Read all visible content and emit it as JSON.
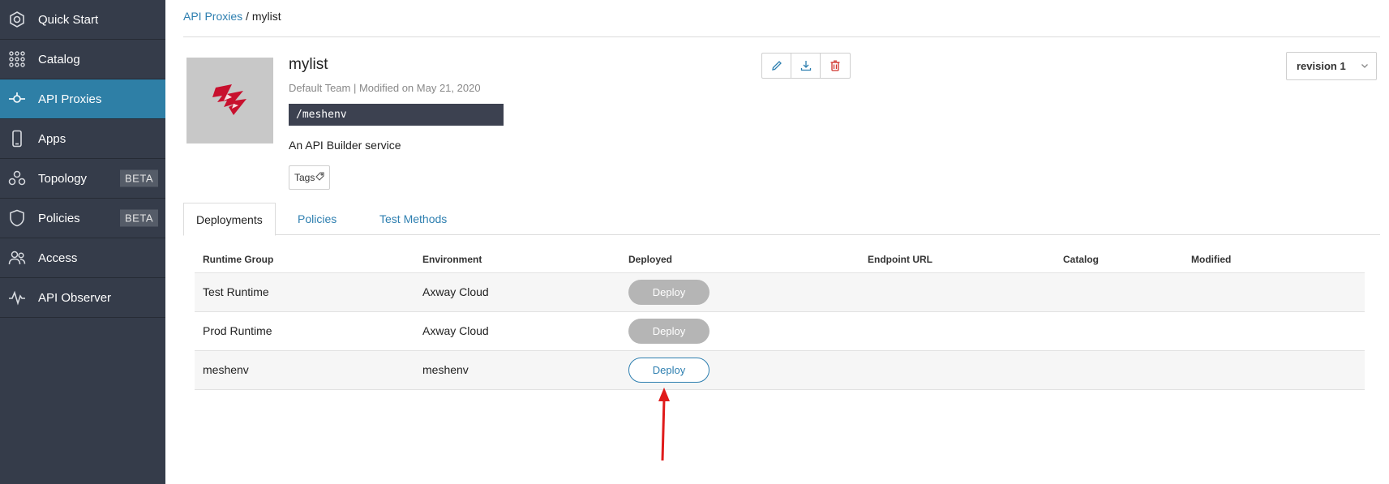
{
  "sidebar": {
    "items": [
      {
        "label": "Quick Start",
        "icon": "quick-start-icon"
      },
      {
        "label": "Catalog",
        "icon": "catalog-grid-icon"
      },
      {
        "label": "API Proxies",
        "icon": "api-proxies-icon",
        "active": true
      },
      {
        "label": "Apps",
        "icon": "phone-icon"
      },
      {
        "label": "Topology",
        "icon": "topology-icon",
        "badge": "BETA"
      },
      {
        "label": "Policies",
        "icon": "shield-icon",
        "badge": "BETA"
      },
      {
        "label": "Access",
        "icon": "users-icon"
      },
      {
        "label": "API Observer",
        "icon": "pulse-icon"
      }
    ]
  },
  "breadcrumb": {
    "parent": "API Proxies",
    "separator": "/",
    "current": "mylist"
  },
  "proxy": {
    "name": "mylist",
    "meta": "Default Team | Modified on May 21, 2020",
    "path": "/meshenv",
    "description": "An API Builder service",
    "tags_label": "Tags",
    "revision": "revision 1"
  },
  "tabs": [
    {
      "label": "Deployments",
      "active": true
    },
    {
      "label": "Policies"
    },
    {
      "label": "Test Methods"
    }
  ],
  "table": {
    "headers": [
      "Runtime Group",
      "Environment",
      "Deployed",
      "Endpoint URL",
      "Catalog",
      "Modified"
    ],
    "rows": [
      {
        "runtime_group": "Test Runtime",
        "environment": "Axway Cloud",
        "deploy_label": "Deploy",
        "deploy_state": "disabled"
      },
      {
        "runtime_group": "Prod Runtime",
        "environment": "Axway Cloud",
        "deploy_label": "Deploy",
        "deploy_state": "disabled"
      },
      {
        "runtime_group": "meshenv",
        "environment": "meshenv",
        "deploy_label": "Deploy",
        "deploy_state": "enabled"
      }
    ]
  },
  "colors": {
    "sidebar_bg": "#353c4a",
    "active_nav": "#2e7fa6",
    "link": "#2e7fb0",
    "annotation_arrow": "#e01b1b",
    "logo_red": "#c8102e"
  }
}
